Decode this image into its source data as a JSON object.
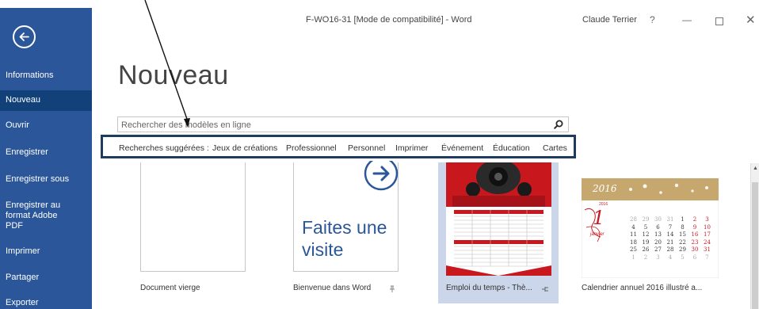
{
  "window": {
    "title": "F-WO16-31 [Mode de compatibilité] - Word",
    "user": "Claude Terrier",
    "help": "?",
    "minimize": "—",
    "close": "✕"
  },
  "sidebar": {
    "items": [
      {
        "label": "Informations"
      },
      {
        "label": "Nouveau"
      },
      {
        "label": "Ouvrir"
      },
      {
        "label": "Enregistrer"
      },
      {
        "label": "Enregistrer sous"
      },
      {
        "label_lines": [
          "Enregistrer au",
          "format Adobe",
          "PDF"
        ]
      },
      {
        "label": "Imprimer"
      },
      {
        "label": "Partager"
      },
      {
        "label": "Exporter"
      }
    ],
    "active": "Nouveau"
  },
  "main": {
    "title": "Nouveau",
    "search": {
      "value": "",
      "placeholder": "Rechercher des modèles en ligne"
    },
    "suggested": {
      "label": "Recherches suggérées :",
      "items": [
        "Jeux de créations",
        "Professionnel",
        "Personnel",
        "Imprimer",
        "Événement",
        "Éducation",
        "Cartes"
      ]
    },
    "templates": [
      {
        "name": "Document vierge"
      },
      {
        "name": "Bienvenue dans Word",
        "thumb_text_lines": [
          "Faites une",
          "visite"
        ]
      },
      {
        "name": "Emploi du temps - Thè...",
        "selected": true
      },
      {
        "name": "Calendrier annuel 2016 illustré a...",
        "year": "2016",
        "day": "1",
        "month": "janvier",
        "small_year": "2016"
      }
    ]
  },
  "calendar_numbers": [
    [
      "28",
      "29",
      "30",
      "31",
      "1",
      "2",
      "3"
    ],
    [
      "4",
      "5",
      "6",
      "7",
      "8",
      "9",
      "10"
    ],
    [
      "11",
      "12",
      "13",
      "14",
      "15",
      "16",
      "17"
    ],
    [
      "18",
      "19",
      "20",
      "21",
      "22",
      "23",
      "24"
    ],
    [
      "25",
      "26",
      "27",
      "28",
      "29",
      "30",
      "31"
    ],
    [
      "1",
      "2",
      "3",
      "4",
      "5",
      "6",
      "7"
    ]
  ],
  "colors": {
    "sidebar": "#2b579a",
    "sidebar_active": "#124078",
    "accent_blue": "#2b579a",
    "suggest_border": "#1f3b5e",
    "red_template": "#c8181e"
  }
}
